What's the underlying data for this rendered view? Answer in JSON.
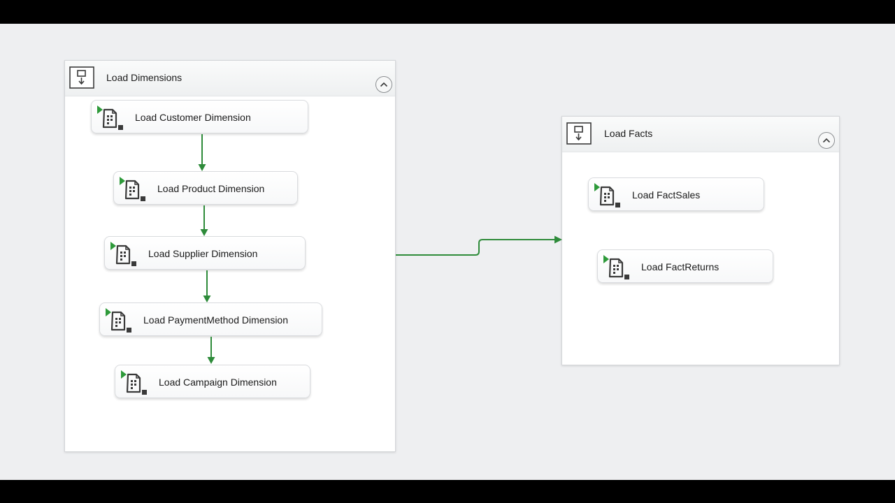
{
  "colors": {
    "connector": "#2e8b3a",
    "canvas": "#eeeff1",
    "task_marker": "#2e9a3a"
  },
  "containers": [
    {
      "title": "Load Dimensions",
      "icon": "sequence-container-icon",
      "tasks": [
        {
          "label": "Load Customer Dimension",
          "icon": "data-flow-task-icon"
        },
        {
          "label": "Load Product Dimension",
          "icon": "data-flow-task-icon"
        },
        {
          "label": "Load Supplier Dimension",
          "icon": "data-flow-task-icon"
        },
        {
          "label": "Load PaymentMethod Dimension",
          "icon": "data-flow-task-icon"
        },
        {
          "label": "Load Campaign Dimension",
          "icon": "data-flow-task-icon"
        }
      ]
    },
    {
      "title": "Load Facts",
      "icon": "sequence-container-icon",
      "tasks": [
        {
          "label": "Load FactSales",
          "icon": "data-flow-task-icon"
        },
        {
          "label": "Load FactReturns",
          "icon": "data-flow-task-icon"
        }
      ]
    }
  ]
}
